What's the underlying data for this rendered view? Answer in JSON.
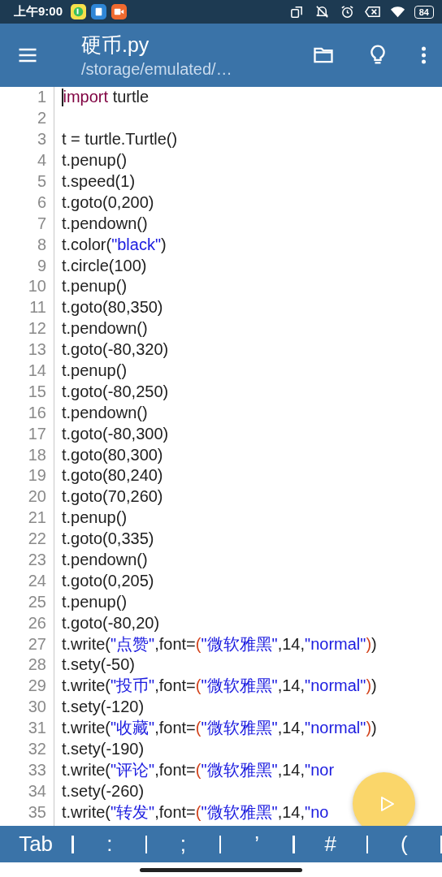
{
  "status_bar": {
    "time": "上午9:00",
    "battery": "84"
  },
  "toolbar": {
    "title": "硬币.py",
    "subtitle": "/storage/emulated/…"
  },
  "editor": {
    "lines": [
      {
        "number": "1",
        "cursor": true,
        "tokens": [
          {
            "kind": "keyword",
            "text": "import"
          },
          {
            "kind": "plain",
            "text": " turtle"
          }
        ]
      },
      {
        "number": "2",
        "cursor": false
      },
      {
        "number": "3",
        "cursor": false,
        "tokens": [
          {
            "kind": "plain",
            "text": "t = turtle.Turtle()"
          }
        ]
      },
      {
        "number": "4",
        "cursor": false,
        "tokens": [
          {
            "kind": "plain",
            "text": "t.penup()"
          }
        ]
      },
      {
        "number": "5",
        "cursor": false,
        "tokens": [
          {
            "kind": "plain",
            "text": "t.speed(1)"
          }
        ]
      },
      {
        "number": "6",
        "cursor": false,
        "tokens": [
          {
            "kind": "plain",
            "text": "t.goto(0,200)"
          }
        ]
      },
      {
        "number": "7",
        "cursor": false,
        "tokens": [
          {
            "kind": "plain",
            "text": "t.pendown()"
          }
        ]
      },
      {
        "number": "8",
        "cursor": false,
        "tokens": [
          {
            "kind": "plain",
            "text": "t.color("
          },
          {
            "kind": "string",
            "text": "\"black\""
          },
          {
            "kind": "plain",
            "text": ")"
          }
        ]
      },
      {
        "number": "9",
        "cursor": false,
        "tokens": [
          {
            "kind": "plain",
            "text": "t.circle(100)"
          }
        ]
      },
      {
        "number": "10",
        "cursor": false,
        "tokens": [
          {
            "kind": "plain",
            "text": "t.penup()"
          }
        ]
      },
      {
        "number": "11",
        "cursor": false,
        "tokens": [
          {
            "kind": "plain",
            "text": "t.goto(80,350)"
          }
        ]
      },
      {
        "number": "12",
        "cursor": false,
        "tokens": [
          {
            "kind": "plain",
            "text": "t.pendown()"
          }
        ]
      },
      {
        "number": "13",
        "cursor": false,
        "tokens": [
          {
            "kind": "plain",
            "text": "t.goto(-80,320)"
          }
        ]
      },
      {
        "number": "14",
        "cursor": false,
        "tokens": [
          {
            "kind": "plain",
            "text": "t.penup()"
          }
        ]
      },
      {
        "number": "15",
        "cursor": false,
        "tokens": [
          {
            "kind": "plain",
            "text": "t.goto(-80,250)"
          }
        ]
      },
      {
        "number": "16",
        "cursor": false,
        "tokens": [
          {
            "kind": "plain",
            "text": "t.pendown()"
          }
        ]
      },
      {
        "number": "17",
        "cursor": false,
        "tokens": [
          {
            "kind": "plain",
            "text": "t.goto(-80,300)"
          }
        ]
      },
      {
        "number": "18",
        "cursor": false,
        "tokens": [
          {
            "kind": "plain",
            "text": "t.goto(80,300)"
          }
        ]
      },
      {
        "number": "19",
        "cursor": false,
        "tokens": [
          {
            "kind": "plain",
            "text": "t.goto(80,240)"
          }
        ]
      },
      {
        "number": "20",
        "cursor": false,
        "tokens": [
          {
            "kind": "plain",
            "text": "t.goto(70,260)"
          }
        ]
      },
      {
        "number": "21",
        "cursor": false,
        "tokens": [
          {
            "kind": "plain",
            "text": "t.penup()"
          }
        ]
      },
      {
        "number": "22",
        "cursor": false,
        "tokens": [
          {
            "kind": "plain",
            "text": "t.goto(0,335)"
          }
        ]
      },
      {
        "number": "23",
        "cursor": false,
        "tokens": [
          {
            "kind": "plain",
            "text": "t.pendown()"
          }
        ]
      },
      {
        "number": "24",
        "cursor": false,
        "tokens": [
          {
            "kind": "plain",
            "text": "t.goto(0,205)"
          }
        ]
      },
      {
        "number": "25",
        "cursor": false,
        "tokens": [
          {
            "kind": "plain",
            "text": "t.penup()"
          }
        ]
      },
      {
        "number": "26",
        "cursor": false,
        "tokens": [
          {
            "kind": "plain",
            "text": "t.goto(-80,20)"
          }
        ]
      },
      {
        "number": "27",
        "cursor": false,
        "tokens": [
          {
            "kind": "plain",
            "text": "t.write("
          },
          {
            "kind": "string",
            "text": "\"点赞\""
          },
          {
            "kind": "plain",
            "text": ",font="
          },
          {
            "kind": "paren",
            "text": "("
          },
          {
            "kind": "string",
            "text": "\"微软雅黑\""
          },
          {
            "kind": "plain",
            "text": ",14,"
          },
          {
            "kind": "string",
            "text": "\"normal\""
          },
          {
            "kind": "paren",
            "text": ")"
          },
          {
            "kind": "plain",
            "text": ")"
          }
        ]
      },
      {
        "number": "28",
        "cursor": false,
        "tokens": [
          {
            "kind": "plain",
            "text": "t.sety(-50)"
          }
        ]
      },
      {
        "number": "29",
        "cursor": false,
        "tokens": [
          {
            "kind": "plain",
            "text": "t.write("
          },
          {
            "kind": "string",
            "text": "\"投币\""
          },
          {
            "kind": "plain",
            "text": ",font="
          },
          {
            "kind": "paren",
            "text": "("
          },
          {
            "kind": "string",
            "text": "\"微软雅黑\""
          },
          {
            "kind": "plain",
            "text": ",14,"
          },
          {
            "kind": "string",
            "text": "\"normal\""
          },
          {
            "kind": "paren",
            "text": ")"
          },
          {
            "kind": "plain",
            "text": ")"
          }
        ]
      },
      {
        "number": "30",
        "cursor": false,
        "tokens": [
          {
            "kind": "plain",
            "text": "t.sety(-120)"
          }
        ]
      },
      {
        "number": "31",
        "cursor": false,
        "tokens": [
          {
            "kind": "plain",
            "text": "t.write("
          },
          {
            "kind": "string",
            "text": "\"收藏\""
          },
          {
            "kind": "plain",
            "text": ",font="
          },
          {
            "kind": "paren",
            "text": "("
          },
          {
            "kind": "string",
            "text": "\"微软雅黑\""
          },
          {
            "kind": "plain",
            "text": ",14,"
          },
          {
            "kind": "string",
            "text": "\"normal\""
          },
          {
            "kind": "paren",
            "text": ")"
          },
          {
            "kind": "plain",
            "text": ")"
          }
        ]
      },
      {
        "number": "32",
        "cursor": false,
        "tokens": [
          {
            "kind": "plain",
            "text": "t.sety(-190)"
          }
        ]
      },
      {
        "number": "33",
        "cursor": false,
        "tokens": [
          {
            "kind": "plain",
            "text": "t.write("
          },
          {
            "kind": "string",
            "text": "\"评论\""
          },
          {
            "kind": "plain",
            "text": ",font="
          },
          {
            "kind": "paren",
            "text": "("
          },
          {
            "kind": "string",
            "text": "\"微软雅黑\""
          },
          {
            "kind": "plain",
            "text": ",14,"
          },
          {
            "kind": "string",
            "text": "\"nor"
          }
        ]
      },
      {
        "number": "34",
        "cursor": false,
        "tokens": [
          {
            "kind": "plain",
            "text": "t.sety(-260)"
          }
        ]
      },
      {
        "number": "35",
        "cursor": false,
        "tokens": [
          {
            "kind": "plain",
            "text": "t.write("
          },
          {
            "kind": "string",
            "text": "\"转发\""
          },
          {
            "kind": "plain",
            "text": ",font="
          },
          {
            "kind": "paren",
            "text": "("
          },
          {
            "kind": "string",
            "text": "\"微软雅黑\""
          },
          {
            "kind": "plain",
            "text": ",14,"
          },
          {
            "kind": "string",
            "text": "\"no"
          }
        ]
      }
    ]
  },
  "key_bar": [
    "Tab",
    ":",
    ";",
    "’",
    "#",
    "("
  ]
}
